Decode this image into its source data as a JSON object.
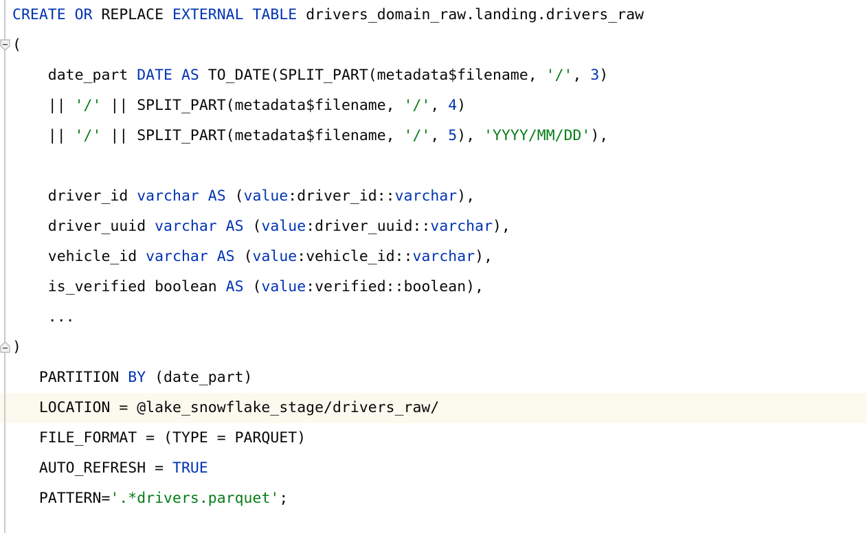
{
  "editor": {
    "language": "sql",
    "theme": "light",
    "colors": {
      "background": "#ffffff",
      "text": "#080808",
      "keyword": "#0033b3",
      "string": "#067d17",
      "number": "#0033b3",
      "caret_line_background": "#fcf9ee",
      "gutter_rail": "#c9c9c9"
    },
    "gutter": {
      "fold_start_icon": "fold-collapse-icon",
      "fold_end_icon": "fold-end-icon"
    }
  },
  "code": {
    "lines": [
      {
        "index": 0,
        "text": "CREATE OR REPLACE EXTERNAL TABLE drivers_domain_raw.landing.drivers_raw",
        "tokens": [
          {
            "t": "CREATE",
            "c": "kw"
          },
          {
            "t": " ",
            "c": "pl"
          },
          {
            "t": "OR",
            "c": "kw"
          },
          {
            "t": " REPLACE ",
            "c": "pl"
          },
          {
            "t": "EXTERNAL",
            "c": "kw"
          },
          {
            "t": " ",
            "c": "pl"
          },
          {
            "t": "TABLE",
            "c": "kw"
          },
          {
            "t": " drivers_domain_raw.landing.drivers_raw",
            "c": "pl"
          }
        ]
      },
      {
        "index": 1,
        "text": "(",
        "fold": "start",
        "tokens": [
          {
            "t": "(",
            "c": "pl"
          }
        ]
      },
      {
        "index": 2,
        "text": "    date_part DATE AS TO_DATE(SPLIT_PART(metadata$filename, '/', 3)",
        "tokens": [
          {
            "t": "    date_part ",
            "c": "pl"
          },
          {
            "t": "DATE",
            "c": "kw"
          },
          {
            "t": " ",
            "c": "pl"
          },
          {
            "t": "AS",
            "c": "kw"
          },
          {
            "t": " TO_DATE(SPLIT_PART(metadata$filename, ",
            "c": "pl"
          },
          {
            "t": "'/'",
            "c": "str"
          },
          {
            "t": ", ",
            "c": "pl"
          },
          {
            "t": "3",
            "c": "num"
          },
          {
            "t": ")",
            "c": "pl"
          }
        ]
      },
      {
        "index": 3,
        "text": "    || '/' || SPLIT_PART(metadata$filename, '/', 4)",
        "tokens": [
          {
            "t": "    || ",
            "c": "pl"
          },
          {
            "t": "'/'",
            "c": "str"
          },
          {
            "t": " || SPLIT_PART(metadata$filename, ",
            "c": "pl"
          },
          {
            "t": "'/'",
            "c": "str"
          },
          {
            "t": ", ",
            "c": "pl"
          },
          {
            "t": "4",
            "c": "num"
          },
          {
            "t": ")",
            "c": "pl"
          }
        ]
      },
      {
        "index": 4,
        "text": "    || '/' || SPLIT_PART(metadata$filename, '/', 5), 'YYYY/MM/DD'),",
        "tokens": [
          {
            "t": "    || ",
            "c": "pl"
          },
          {
            "t": "'/'",
            "c": "str"
          },
          {
            "t": " || SPLIT_PART(metadata$filename, ",
            "c": "pl"
          },
          {
            "t": "'/'",
            "c": "str"
          },
          {
            "t": ", ",
            "c": "pl"
          },
          {
            "t": "5",
            "c": "num"
          },
          {
            "t": "), ",
            "c": "pl"
          },
          {
            "t": "'YYYY/MM/DD'",
            "c": "str"
          },
          {
            "t": "),",
            "c": "pl"
          }
        ]
      },
      {
        "index": 5,
        "text": "",
        "blank": true,
        "tokens": []
      },
      {
        "index": 6,
        "text": "    driver_id varchar AS (value:driver_id::varchar),",
        "tokens": [
          {
            "t": "    driver_id ",
            "c": "pl"
          },
          {
            "t": "varchar",
            "c": "kw"
          },
          {
            "t": " ",
            "c": "pl"
          },
          {
            "t": "AS",
            "c": "kw"
          },
          {
            "t": " (",
            "c": "pl"
          },
          {
            "t": "value",
            "c": "kw"
          },
          {
            "t": ":driver_id::",
            "c": "pl"
          },
          {
            "t": "varchar",
            "c": "kw"
          },
          {
            "t": "),",
            "c": "pl"
          }
        ]
      },
      {
        "index": 7,
        "text": "    driver_uuid varchar AS (value:driver_uuid::varchar),",
        "tokens": [
          {
            "t": "    driver_uuid ",
            "c": "pl"
          },
          {
            "t": "varchar",
            "c": "kw"
          },
          {
            "t": " ",
            "c": "pl"
          },
          {
            "t": "AS",
            "c": "kw"
          },
          {
            "t": " (",
            "c": "pl"
          },
          {
            "t": "value",
            "c": "kw"
          },
          {
            "t": ":driver_uuid::",
            "c": "pl"
          },
          {
            "t": "varchar",
            "c": "kw"
          },
          {
            "t": "),",
            "c": "pl"
          }
        ]
      },
      {
        "index": 8,
        "text": "    vehicle_id varchar AS (value:vehicle_id::varchar),",
        "tokens": [
          {
            "t": "    vehicle_id ",
            "c": "pl"
          },
          {
            "t": "varchar",
            "c": "kw"
          },
          {
            "t": " ",
            "c": "pl"
          },
          {
            "t": "AS",
            "c": "kw"
          },
          {
            "t": " (",
            "c": "pl"
          },
          {
            "t": "value",
            "c": "kw"
          },
          {
            "t": ":vehicle_id::",
            "c": "pl"
          },
          {
            "t": "varchar",
            "c": "kw"
          },
          {
            "t": "),",
            "c": "pl"
          }
        ]
      },
      {
        "index": 9,
        "text": "    is_verified boolean AS (value:verified::boolean),",
        "tokens": [
          {
            "t": "    is_verified boolean ",
            "c": "pl"
          },
          {
            "t": "AS",
            "c": "kw"
          },
          {
            "t": " (",
            "c": "pl"
          },
          {
            "t": "value",
            "c": "kw"
          },
          {
            "t": ":verified::boolean),",
            "c": "pl"
          }
        ]
      },
      {
        "index": 10,
        "text": "    ...",
        "tokens": [
          {
            "t": "    ...",
            "c": "pl"
          }
        ]
      },
      {
        "index": 11,
        "text": ")",
        "fold": "end",
        "tokens": [
          {
            "t": ")",
            "c": "pl"
          }
        ]
      },
      {
        "index": 12,
        "text": "   PARTITION BY (date_part)",
        "tokens": [
          {
            "t": "   PARTITION ",
            "c": "pl"
          },
          {
            "t": "BY",
            "c": "kw"
          },
          {
            "t": " (date_part)",
            "c": "pl"
          }
        ]
      },
      {
        "index": 13,
        "text": "   LOCATION = @lake_snowflake_stage/drivers_raw/",
        "caret": true,
        "tokens": [
          {
            "t": "   LOCATION = @lake_snowflake_stage/drivers_raw/",
            "c": "pl"
          }
        ]
      },
      {
        "index": 14,
        "text": "   FILE_FORMAT = (TYPE = PARQUET)",
        "tokens": [
          {
            "t": "   FILE_FORMAT = (TYPE = PARQUET)",
            "c": "pl"
          }
        ]
      },
      {
        "index": 15,
        "text": "   AUTO_REFRESH = TRUE",
        "tokens": [
          {
            "t": "   AUTO_REFRESH = ",
            "c": "pl"
          },
          {
            "t": "TRUE",
            "c": "kw"
          }
        ]
      },
      {
        "index": 16,
        "text": "   PATTERN='.*drivers.parquet';",
        "tokens": [
          {
            "t": "   PATTERN=",
            "c": "pl"
          },
          {
            "t": "'.*drivers.parquet'",
            "c": "str"
          },
          {
            "t": ";",
            "c": "pl"
          }
        ]
      }
    ]
  }
}
